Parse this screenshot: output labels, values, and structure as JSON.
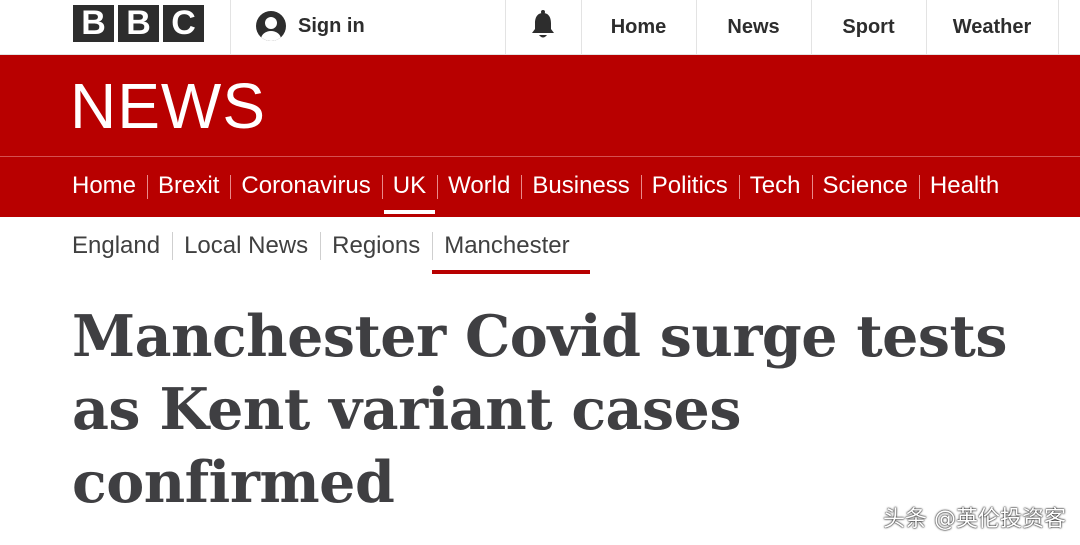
{
  "header": {
    "logo_letters": [
      "B",
      "B",
      "C"
    ],
    "signin_label": "Sign in",
    "icons": {
      "user": "user-icon",
      "notifications": "bell-icon"
    },
    "nav": [
      "Home",
      "News",
      "Sport",
      "Weather"
    ]
  },
  "section": {
    "wordmark": "NEWS",
    "brand_color": "#b80000"
  },
  "main_nav": {
    "items": [
      "Home",
      "Brexit",
      "Coronavirus",
      "UK",
      "World",
      "Business",
      "Politics",
      "Tech",
      "Science",
      "Health"
    ],
    "active": "UK"
  },
  "sub_nav": {
    "items": [
      "England",
      "Local News",
      "Regions",
      "Manchester"
    ],
    "active": "Manchester"
  },
  "article": {
    "headline": "Manchester Covid surge tests as Kent variant cases confirmed"
  },
  "watermark": "头条 @英伦投资客"
}
